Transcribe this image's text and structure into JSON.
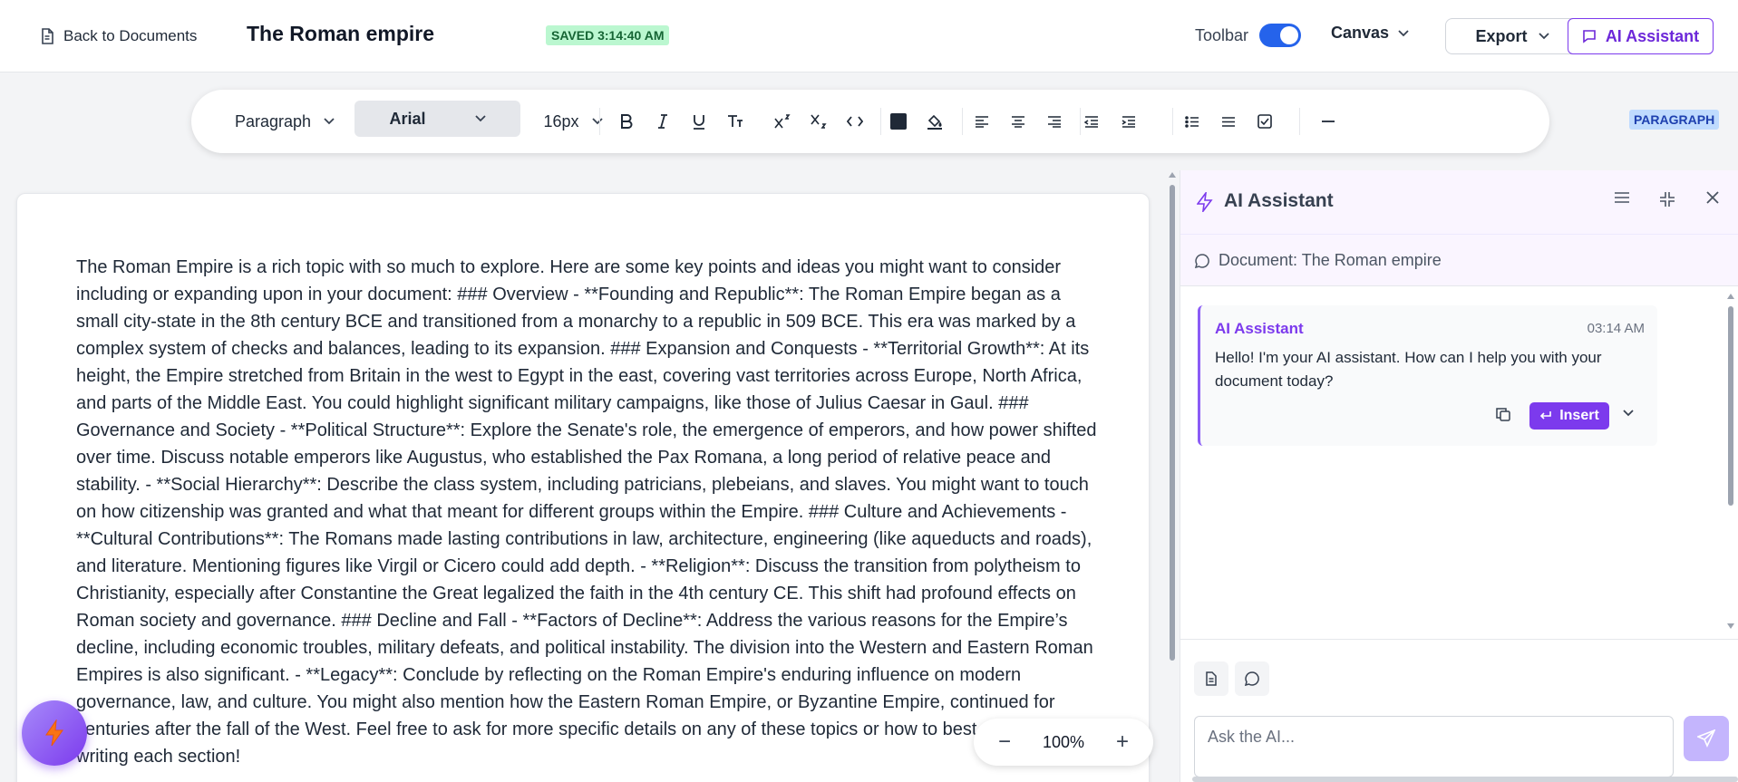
{
  "header": {
    "back_label": "Back to Documents",
    "title": "The Roman empire",
    "saved_status": "SAVED 3:14:40 AM",
    "toolbar_label": "Toolbar",
    "canvas_label": "Canvas",
    "export_label": "Export",
    "ai_assistant_label": "AI Assistant"
  },
  "format_toolbar": {
    "block_type": "Paragraph",
    "font_family": "Arial",
    "font_size": "16px",
    "block_badge": "PARAGRAPH"
  },
  "editor": {
    "content": "The Roman Empire is a rich topic with so much to explore. Here are some key points and ideas you might want to consider including or expanding upon in your document: ### Overview - **Founding and Republic**: The Roman Empire began as a small city-state in the 8th century BCE and transitioned from a monarchy to a republic in 509 BCE. This era was marked by a complex system of checks and balances, leading to its expansion. ### Expansion and Conquests - **Territorial Growth**: At its height, the Empire stretched from Britain in the west to Egypt in the east, covering vast territories across Europe, North Africa, and parts of the Middle East. You could highlight significant military campaigns, like those of Julius Caesar in Gaul. ### Governance and Society - **Political Structure**: Explore the Senate's role, the emergence of emperors, and how power shifted over time. Discuss notable emperors like Augustus, who established the Pax Romana, a long period of relative peace and stability. - **Social Hierarchy**: Describe the class system, including patricians, plebeians, and slaves. You might want to touch on how citizenship was granted and what that meant for different groups within the Empire. ### Culture and Achievements - **Cultural Contributions**: The Romans made lasting contributions in law, architecture, engineering (like aqueducts and roads), and literature. Mentioning figures like Virgil or Cicero could add depth. - **Religion**: Discuss the transition from polytheism to Christianity, especially after Constantine the Great legalized the faith in the 4th century CE. This shift had profound effects on Roman society and governance. ### Decline and Fall - **Factors of Decline**: Address the various reasons for the Empire’s decline, including economic troubles, military defeats, and political instability. The division into the Western and Eastern Roman Empires is also significant. - **Legacy**: Conclude by reflecting on the Roman Empire's enduring influence on modern governance, law, and culture. You might also mention how the Eastern Roman Empire, or Byzantine Empire, continued for centuries after the fall of the West. Feel free to ask for more specific details on any of these topics or how to best approach writing each section!"
  },
  "zoom": {
    "minus": "−",
    "value": "100%",
    "plus": "+"
  },
  "ai_panel": {
    "title": "AI Assistant",
    "document_label": "Document: The Roman empire",
    "messages": [
      {
        "author": "AI Assistant",
        "time": "03:14 AM",
        "text": "Hello! I'm your AI assistant. How can I help you with your document today?",
        "insert_label": "Insert"
      }
    ],
    "input_placeholder": "Ask the AI..."
  },
  "colors": {
    "accent": "#7c3aed",
    "toggle_on": "#2563eb",
    "saved_bg": "#bbf7d0",
    "text_color_swatch": "#1f2937"
  }
}
